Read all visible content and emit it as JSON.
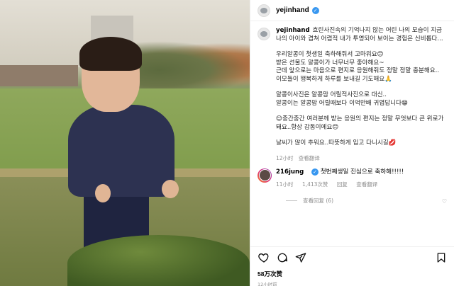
{
  "post": {
    "username": "yejinhand",
    "caption_lines": [
      "흐린사진속의 기억나지 않는 어린 나의 모습이 지금 나의 아이와 겹쳐 어렴적 내가 투영되어 보이는 경험은 신비롭다...",
      "우리알콩이 첫생일 축하해줘서 고마워요😊\n받은 선물도 알콩이가 너무너무 좋아해요~\n근데 앞으로는 마음으로 편지로 응원해줘도 정말 정말 충분해요..\n이모들이 행복하게 하루를 보내길 기도해요🙏",
      "알콩이사진은 알콩맘 어릴적사진으로 대신..\n알콩이는 알콩맘 어릴때보다 이억만배 귀엽답니다😁",
      "😊중간중간 여러분께 받는 응원의 편지는 정말 무엇보다 큰 위로가 돼요..항상 감동이에요😊",
      "날씨가 많이 추워요..따뜻하게 입고 다니시길💋"
    ],
    "caption_time": "12小时",
    "caption_translate": "查看翻译"
  },
  "comment": {
    "username": "216jung",
    "text": "첫번째생일 진심으로 축하해!!!!!",
    "time": "11小时",
    "likes": "1,413次赞",
    "reply": "回复",
    "translate": "查看翻译",
    "view_replies": "查看回复 (6)"
  },
  "footer": {
    "likes": "58万次赞",
    "time": "12小时前"
  },
  "icons": {
    "verified": "verified-badge-icon",
    "like": "heart-icon",
    "comment": "comment-icon",
    "share": "send-icon",
    "save": "bookmark-icon"
  },
  "colors": {
    "verified": "#3897f0",
    "meta": "#8e8e8e"
  }
}
